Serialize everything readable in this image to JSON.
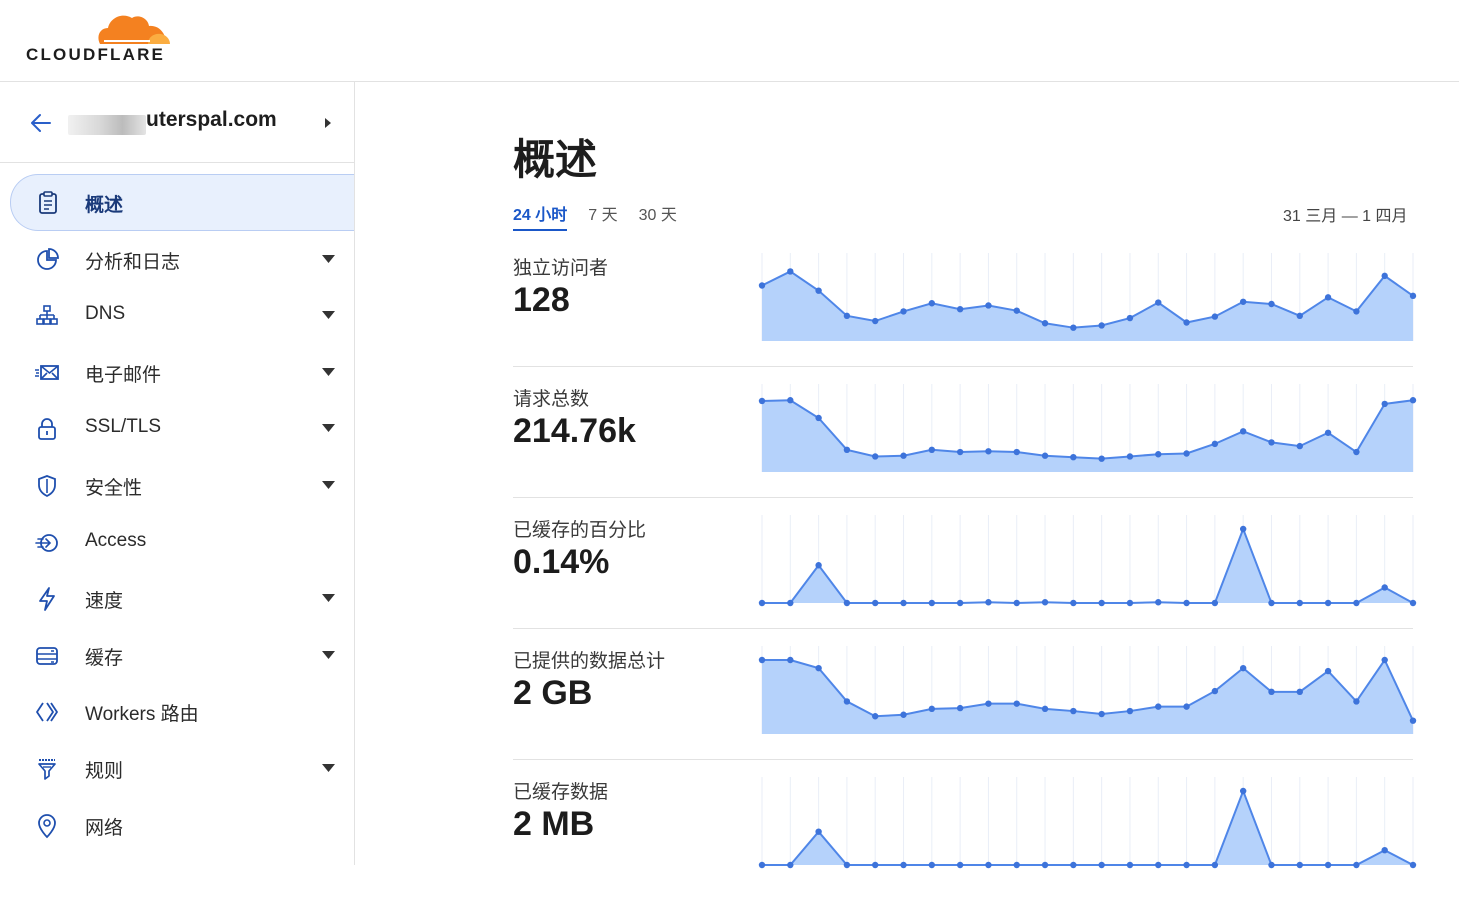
{
  "brand": {
    "name": "CLOUDFLARE",
    "logo_color": "#f48120"
  },
  "site": {
    "domain_visible": "uterspal.com"
  },
  "sidebar": {
    "items": [
      {
        "label": "概述",
        "icon": "clipboard-icon",
        "active": true,
        "expandable": false
      },
      {
        "label": "分析和日志",
        "icon": "pie-chart-icon",
        "active": false,
        "expandable": true
      },
      {
        "label": "DNS",
        "icon": "network-tree-icon",
        "active": false,
        "expandable": true
      },
      {
        "label": "电子邮件",
        "icon": "envelope-icon",
        "active": false,
        "expandable": true
      },
      {
        "label": "SSL/TLS",
        "icon": "lock-icon",
        "active": false,
        "expandable": true
      },
      {
        "label": "安全性",
        "icon": "shield-icon",
        "active": false,
        "expandable": true
      },
      {
        "label": "Access",
        "icon": "access-icon",
        "active": false,
        "expandable": false
      },
      {
        "label": "速度",
        "icon": "lightning-icon",
        "active": false,
        "expandable": true
      },
      {
        "label": "缓存",
        "icon": "storage-icon",
        "active": false,
        "expandable": true
      },
      {
        "label": "Workers 路由",
        "icon": "workers-icon",
        "active": false,
        "expandable": false
      },
      {
        "label": "规则",
        "icon": "filter-icon",
        "active": false,
        "expandable": true
      },
      {
        "label": "网络",
        "icon": "location-pin-icon",
        "active": false,
        "expandable": false
      }
    ]
  },
  "main": {
    "title": "概述",
    "range_tabs": [
      {
        "label": "24 小时",
        "active": true
      },
      {
        "label": "7 天",
        "active": false
      },
      {
        "label": "30 天",
        "active": false
      }
    ],
    "date_range": "31 三月 — 1 四月"
  },
  "colors": {
    "accent": "#1a57c8",
    "chart_fill": "#b5d2fb",
    "chart_line": "#4f86e8",
    "chart_point": "#3d73da"
  },
  "chart_data": [
    {
      "type": "area",
      "title": "独立访问者",
      "value": "128",
      "ylim": [
        0,
        100
      ],
      "values": [
        75,
        94,
        68,
        34,
        27,
        40,
        51,
        43,
        48,
        41,
        24,
        18,
        21,
        31,
        52,
        25,
        33,
        53,
        50,
        34,
        59,
        40,
        88,
        61
      ]
    },
    {
      "type": "area",
      "title": "请求总数",
      "value": "214.76k",
      "ylim": [
        0,
        100
      ],
      "values": [
        96,
        97,
        73,
        30,
        21,
        22,
        30,
        27,
        28,
        27,
        22,
        20,
        18,
        21,
        24,
        25,
        38,
        55,
        40,
        35,
        53,
        27,
        92,
        97
      ]
    },
    {
      "type": "area",
      "title": "已缓存的百分比",
      "value": "0.14%",
      "ylim": [
        0,
        100
      ],
      "values": [
        0,
        0,
        51,
        0,
        0,
        0,
        0,
        0,
        1,
        0,
        1,
        0,
        0,
        0,
        1,
        0,
        0,
        100,
        0,
        0,
        0,
        0,
        21,
        0
      ]
    },
    {
      "type": "area",
      "title": "已提供的数据总计",
      "value": "2 GB",
      "ylim": [
        0,
        100
      ],
      "values": [
        100,
        100,
        89,
        44,
        24,
        26,
        34,
        35,
        41,
        41,
        34,
        31,
        27,
        31,
        37,
        37,
        58,
        89,
        57,
        57,
        85,
        44,
        100,
        18
      ]
    },
    {
      "type": "area",
      "title": "已缓存数据",
      "value": "2 MB",
      "ylim": [
        0,
        100
      ],
      "values": [
        0,
        0,
        45,
        0,
        0,
        0,
        0,
        0,
        0,
        0,
        0,
        0,
        0,
        0,
        0,
        0,
        0,
        100,
        0,
        0,
        0,
        0,
        20,
        0
      ]
    }
  ]
}
